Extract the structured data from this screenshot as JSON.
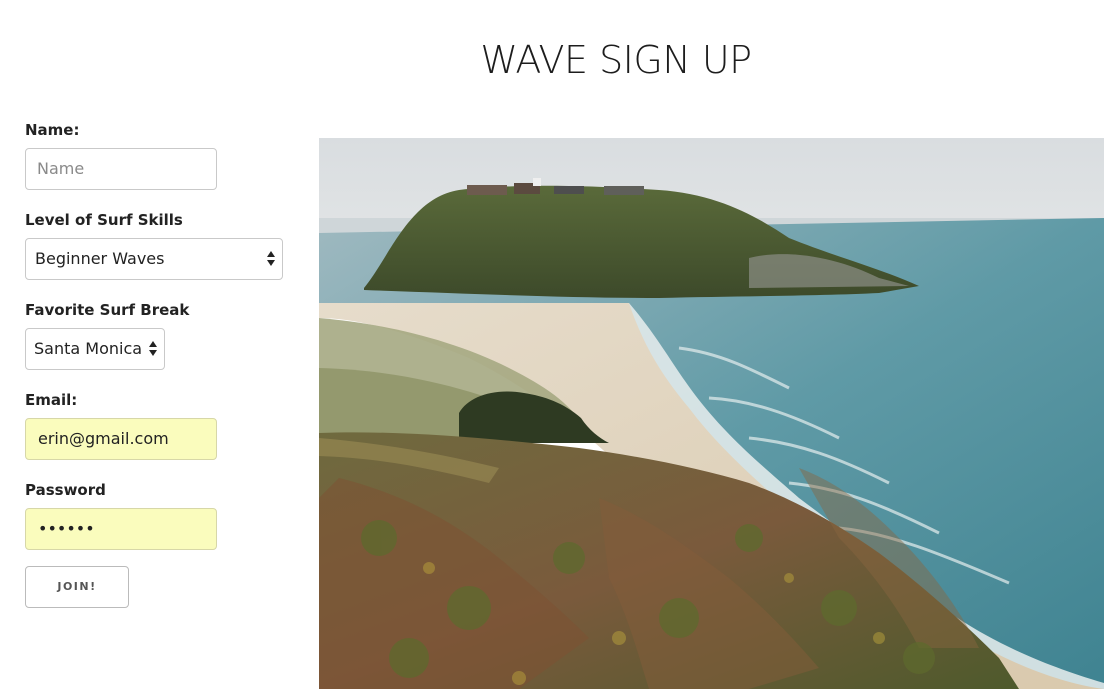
{
  "page": {
    "title": "WAVE SIGN UP"
  },
  "form": {
    "name": {
      "label": "Name:",
      "value": "",
      "placeholder": "Name"
    },
    "skill": {
      "label": "Level of Surf Skills",
      "selected": "Beginner Waves"
    },
    "surf_break": {
      "label": "Favorite Surf Break",
      "selected": "Santa Monica"
    },
    "email": {
      "label": "Email:",
      "value": "erin@gmail.com"
    },
    "password": {
      "label": "Password",
      "masked_value": "••••••"
    },
    "submit_label": "JOIN!"
  },
  "colors": {
    "autofill_background": "#fafcbd",
    "title_text": "#1d1d1d"
  },
  "image": {
    "subject": "coastal headland with beach and ocean"
  }
}
